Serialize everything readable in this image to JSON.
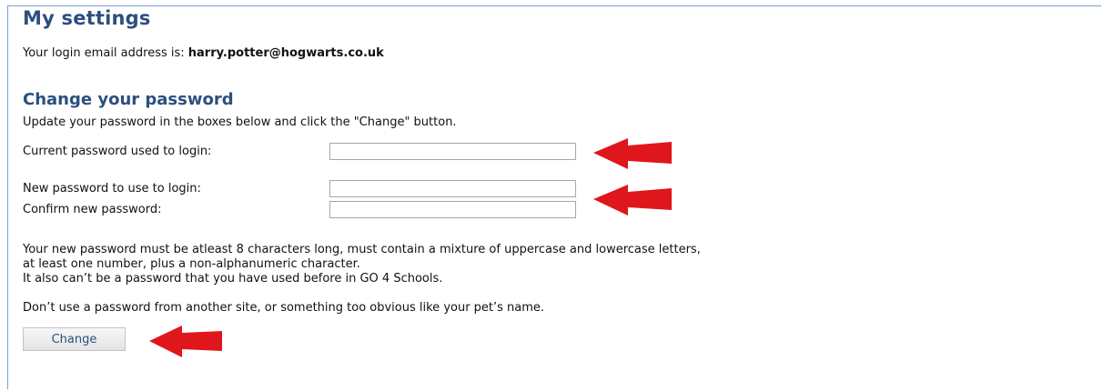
{
  "page": {
    "title": "My settings",
    "login_prefix": "Your login email address is:",
    "login_email": "harry.potter@hogwarts.co.uk"
  },
  "password_section": {
    "title": "Change your password",
    "instructions": "Update your password in the boxes below and click the \"Change\" button.",
    "current_label": "Current password used to login:",
    "current_value": "",
    "new_label": "New password to use to login:",
    "new_value": "",
    "confirm_label": "Confirm new password:",
    "confirm_value": "",
    "rule_line1": "Your new password must be atleast 8 characters long, must contain a mixture of uppercase and lowercase letters,",
    "rule_line2": "at least one number, plus a non-alphanumeric character.",
    "rule_line3": "It also can’t be a password that you have used before in GO 4 Schools.",
    "advice": "Don’t use a password from another site, or something too obvious like your pet’s name.",
    "change_button": "Change"
  },
  "colors": {
    "heading": "#2b4f7f",
    "arrow": "#e0161d"
  },
  "icons": [
    "arrow-left-icon",
    "arrow-left-icon",
    "arrow-left-icon"
  ]
}
